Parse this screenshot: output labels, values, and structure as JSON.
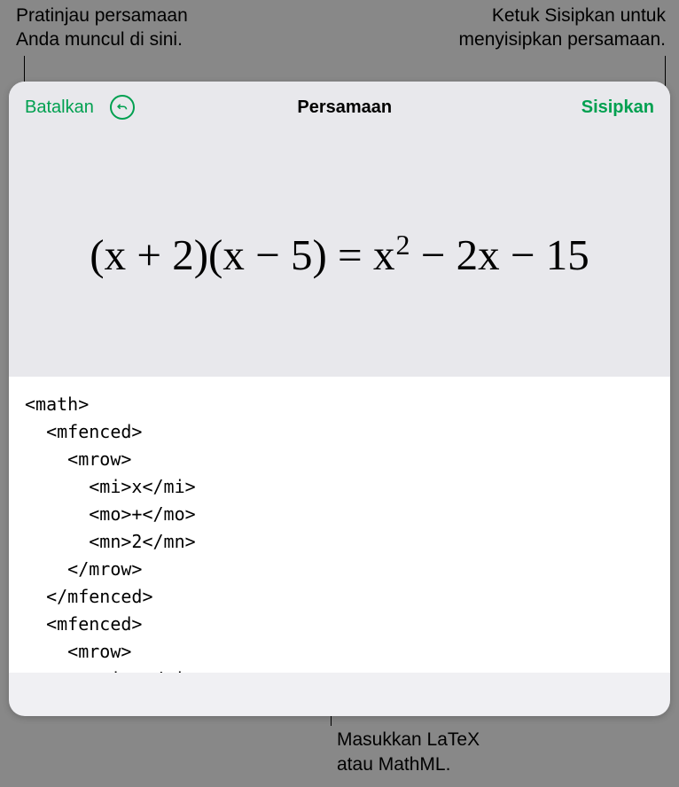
{
  "callouts": {
    "topleft": "Pratinjau persamaan\nAnda muncul di sini.",
    "topright": "Ketuk Sisipkan untuk\nmenyisipkan persamaan.",
    "bottom": "Masukkan LaTeX\natau MathML."
  },
  "toolbar": {
    "cancel_label": "Batalkan",
    "title": "Persamaan",
    "insert_label": "Sisipkan"
  },
  "equation_preview": {
    "html": "(x + 2)(x − 5) = x<sup>2</sup> − 2x − 15"
  },
  "code_area": {
    "content": "<math>\n  <mfenced>\n    <mrow>\n      <mi>x</mi>\n      <mo>+</mo>\n      <mn>2</mn>\n    </mrow>\n  </mfenced>\n  <mfenced>\n    <mrow>\n      <mi>x</mi>\n      <mo>-</mo>"
  }
}
